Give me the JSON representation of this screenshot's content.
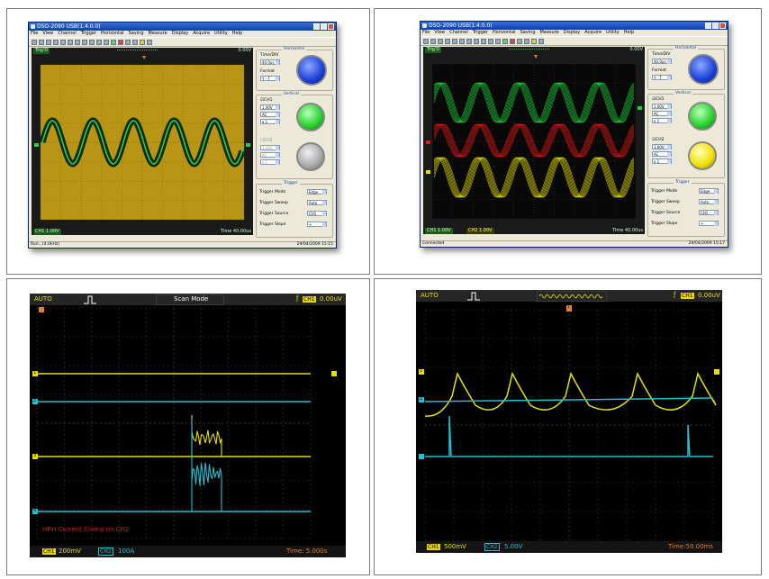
{
  "colors": {
    "window_bg": "#ece9d8",
    "title_blue": "#0a3fb0",
    "screen_tl": "#b89514",
    "grid_dark": "#2a2a2a",
    "ch1": "#e6e000",
    "ch2": "#22c0d0",
    "green": "#1fcf3c",
    "red": "#e01818"
  },
  "top_left": {
    "window_title": "DSO-2090 USB(1.4.0.0)",
    "menu": [
      "File",
      "View",
      "Channel",
      "Trigger",
      "Horizontal",
      "Saving",
      "Measure",
      "Display",
      "Acquire",
      "Utility",
      "Help"
    ],
    "scope_label": "Trig'D",
    "trigger_readout": "0.00V",
    "panel": {
      "horizontal_title": "Horizontal",
      "time_div_label": "Time/DIV",
      "time_div_value": "40.0us",
      "format_label": "Format",
      "format_value": "Y - T",
      "vertical_title": "Vertical",
      "ch1_label": "CH1",
      "ch1_volt": "1.00V",
      "ch1_coupling": "AC",
      "ch1_probe": "x 1",
      "ch2_label": "CH2",
      "ch2_volt": "1.00V",
      "ch2_coupling": "AC",
      "ch2_probe": "x 1",
      "trigger_title": "Trigger",
      "trigger_mode_label": "Trigger Mode",
      "trigger_mode_value": "Edge",
      "trigger_sweep_label": "Trigger Sweep",
      "trigger_sweep_value": "Auto",
      "trigger_source_label": "Trigger Source",
      "trigger_source_value": "CH1",
      "trigger_slope_label": "Trigger Slope",
      "trigger_slope_value": "+"
    },
    "bottom_left": "CH1 1.00V",
    "bottom_right": "Time 40.00us",
    "status_left": "Run...(4.0kHz)",
    "status_right": "29/04/2009   15:15"
  },
  "top_right": {
    "window_title": "DSO-2090 USB(1.4.0.0)",
    "menu": [
      "File",
      "View",
      "Channel",
      "Trigger",
      "Horizontal",
      "Saving",
      "Measure",
      "Display",
      "Acquire",
      "Utility",
      "Help"
    ],
    "scope_label": "Trig'D",
    "trigger_readout": "0.00V",
    "panel": {
      "horizontal_title": "Horizontal",
      "time_div_label": "Time/DIV",
      "time_div_value": "40.0us",
      "format_label": "Format",
      "format_value": "Y - T",
      "vertical_title": "Vertical",
      "ch1_label": "CH1",
      "ch1_volt": "1.00V",
      "ch1_coupling": "AC",
      "ch1_probe": "x 1",
      "ch2_label": "CH2",
      "ch2_volt": "1.00V",
      "ch2_coupling": "AC",
      "ch2_probe": "x 1",
      "trigger_title": "Trigger",
      "trigger_mode_label": "Trigger Mode",
      "trigger_mode_value": "Edge",
      "trigger_sweep_label": "Trigger Sweep",
      "trigger_sweep_value": "Auto",
      "trigger_source_label": "Trigger Source",
      "trigger_source_value": "CH1",
      "trigger_slope_label": "Trigger Slope",
      "trigger_slope_value": "+"
    },
    "bottom_left_1": "CH1 1.00V",
    "bottom_left_2": "CH2 1.00V",
    "bottom_right": "Time 40.00us",
    "status_left": "Connected",
    "status_right": "29/04/2009   15:17"
  },
  "bottom_left": {
    "top_mode": "AUTO",
    "center_label": "Scan Mode",
    "top_right_badge": "CH1",
    "top_right_value": "0.00uV",
    "marker_1": "1",
    "marker_2": "2",
    "marker_3": "3",
    "marker_4": "4",
    "annotation": "HRH Current Clamp on CH2",
    "ch1_badge": "CH1",
    "ch1_value": "200mV",
    "ch2_badge": "CH2",
    "ch2_value": "100A",
    "time_readout": "Time: 5.000s"
  },
  "bottom_right": {
    "top_mode": "AUTO",
    "top_right_badge": "CH1",
    "top_right_value": "0.00uV",
    "marker_t": "T",
    "marker_1": "1",
    "marker_2": "2",
    "ch1_badge": "CH1",
    "ch1_value": "500mV",
    "ch2_badge": "CH2",
    "ch2_value": "5.00V",
    "time_readout": "Time:50.00ms"
  }
}
